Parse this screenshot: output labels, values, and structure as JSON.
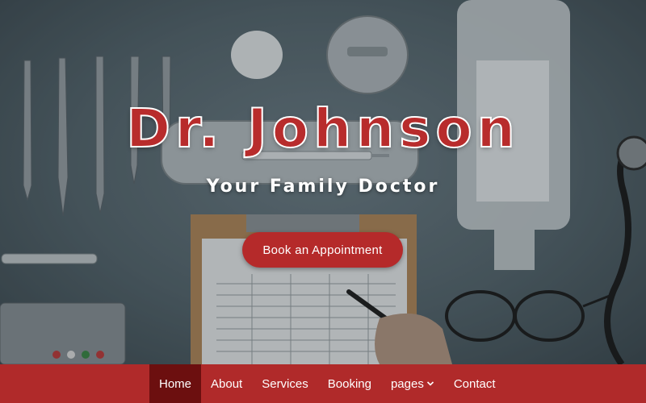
{
  "hero": {
    "title": "Dr. Johnson",
    "subtitle": "Your Family Doctor",
    "cta_label": "Book an Appointment",
    "background_image": "medical-desk-flatlay"
  },
  "nav": {
    "items": [
      {
        "label": "Home",
        "active": true
      },
      {
        "label": "About",
        "active": false
      },
      {
        "label": "Services",
        "active": false
      },
      {
        "label": "Booking",
        "active": false
      },
      {
        "label": "pages",
        "active": false,
        "dropdown": true
      },
      {
        "label": "Contact",
        "active": false
      }
    ]
  },
  "colors": {
    "brand_red": "#b02a2a",
    "active_nav": "#6c0f0f",
    "backdrop": "#5a6b73"
  }
}
